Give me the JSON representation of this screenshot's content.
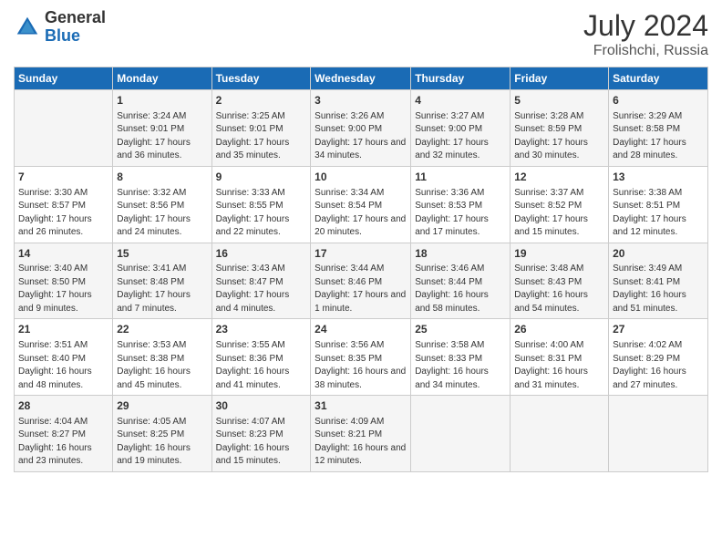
{
  "logo": {
    "general": "General",
    "blue": "Blue"
  },
  "title": {
    "month": "July 2024",
    "location": "Frolishchi, Russia"
  },
  "headers": [
    "Sunday",
    "Monday",
    "Tuesday",
    "Wednesday",
    "Thursday",
    "Friday",
    "Saturday"
  ],
  "weeks": [
    [
      {
        "day": "",
        "sunrise": "",
        "sunset": "",
        "daylight": ""
      },
      {
        "day": "1",
        "sunrise": "Sunrise: 3:24 AM",
        "sunset": "Sunset: 9:01 PM",
        "daylight": "Daylight: 17 hours and 36 minutes."
      },
      {
        "day": "2",
        "sunrise": "Sunrise: 3:25 AM",
        "sunset": "Sunset: 9:01 PM",
        "daylight": "Daylight: 17 hours and 35 minutes."
      },
      {
        "day": "3",
        "sunrise": "Sunrise: 3:26 AM",
        "sunset": "Sunset: 9:00 PM",
        "daylight": "Daylight: 17 hours and 34 minutes."
      },
      {
        "day": "4",
        "sunrise": "Sunrise: 3:27 AM",
        "sunset": "Sunset: 9:00 PM",
        "daylight": "Daylight: 17 hours and 32 minutes."
      },
      {
        "day": "5",
        "sunrise": "Sunrise: 3:28 AM",
        "sunset": "Sunset: 8:59 PM",
        "daylight": "Daylight: 17 hours and 30 minutes."
      },
      {
        "day": "6",
        "sunrise": "Sunrise: 3:29 AM",
        "sunset": "Sunset: 8:58 PM",
        "daylight": "Daylight: 17 hours and 28 minutes."
      }
    ],
    [
      {
        "day": "7",
        "sunrise": "Sunrise: 3:30 AM",
        "sunset": "Sunset: 8:57 PM",
        "daylight": "Daylight: 17 hours and 26 minutes."
      },
      {
        "day": "8",
        "sunrise": "Sunrise: 3:32 AM",
        "sunset": "Sunset: 8:56 PM",
        "daylight": "Daylight: 17 hours and 24 minutes."
      },
      {
        "day": "9",
        "sunrise": "Sunrise: 3:33 AM",
        "sunset": "Sunset: 8:55 PM",
        "daylight": "Daylight: 17 hours and 22 minutes."
      },
      {
        "day": "10",
        "sunrise": "Sunrise: 3:34 AM",
        "sunset": "Sunset: 8:54 PM",
        "daylight": "Daylight: 17 hours and 20 minutes."
      },
      {
        "day": "11",
        "sunrise": "Sunrise: 3:36 AM",
        "sunset": "Sunset: 8:53 PM",
        "daylight": "Daylight: 17 hours and 17 minutes."
      },
      {
        "day": "12",
        "sunrise": "Sunrise: 3:37 AM",
        "sunset": "Sunset: 8:52 PM",
        "daylight": "Daylight: 17 hours and 15 minutes."
      },
      {
        "day": "13",
        "sunrise": "Sunrise: 3:38 AM",
        "sunset": "Sunset: 8:51 PM",
        "daylight": "Daylight: 17 hours and 12 minutes."
      }
    ],
    [
      {
        "day": "14",
        "sunrise": "Sunrise: 3:40 AM",
        "sunset": "Sunset: 8:50 PM",
        "daylight": "Daylight: 17 hours and 9 minutes."
      },
      {
        "day": "15",
        "sunrise": "Sunrise: 3:41 AM",
        "sunset": "Sunset: 8:48 PM",
        "daylight": "Daylight: 17 hours and 7 minutes."
      },
      {
        "day": "16",
        "sunrise": "Sunrise: 3:43 AM",
        "sunset": "Sunset: 8:47 PM",
        "daylight": "Daylight: 17 hours and 4 minutes."
      },
      {
        "day": "17",
        "sunrise": "Sunrise: 3:44 AM",
        "sunset": "Sunset: 8:46 PM",
        "daylight": "Daylight: 17 hours and 1 minute."
      },
      {
        "day": "18",
        "sunrise": "Sunrise: 3:46 AM",
        "sunset": "Sunset: 8:44 PM",
        "daylight": "Daylight: 16 hours and 58 minutes."
      },
      {
        "day": "19",
        "sunrise": "Sunrise: 3:48 AM",
        "sunset": "Sunset: 8:43 PM",
        "daylight": "Daylight: 16 hours and 54 minutes."
      },
      {
        "day": "20",
        "sunrise": "Sunrise: 3:49 AM",
        "sunset": "Sunset: 8:41 PM",
        "daylight": "Daylight: 16 hours and 51 minutes."
      }
    ],
    [
      {
        "day": "21",
        "sunrise": "Sunrise: 3:51 AM",
        "sunset": "Sunset: 8:40 PM",
        "daylight": "Daylight: 16 hours and 48 minutes."
      },
      {
        "day": "22",
        "sunrise": "Sunrise: 3:53 AM",
        "sunset": "Sunset: 8:38 PM",
        "daylight": "Daylight: 16 hours and 45 minutes."
      },
      {
        "day": "23",
        "sunrise": "Sunrise: 3:55 AM",
        "sunset": "Sunset: 8:36 PM",
        "daylight": "Daylight: 16 hours and 41 minutes."
      },
      {
        "day": "24",
        "sunrise": "Sunrise: 3:56 AM",
        "sunset": "Sunset: 8:35 PM",
        "daylight": "Daylight: 16 hours and 38 minutes."
      },
      {
        "day": "25",
        "sunrise": "Sunrise: 3:58 AM",
        "sunset": "Sunset: 8:33 PM",
        "daylight": "Daylight: 16 hours and 34 minutes."
      },
      {
        "day": "26",
        "sunrise": "Sunrise: 4:00 AM",
        "sunset": "Sunset: 8:31 PM",
        "daylight": "Daylight: 16 hours and 31 minutes."
      },
      {
        "day": "27",
        "sunrise": "Sunrise: 4:02 AM",
        "sunset": "Sunset: 8:29 PM",
        "daylight": "Daylight: 16 hours and 27 minutes."
      }
    ],
    [
      {
        "day": "28",
        "sunrise": "Sunrise: 4:04 AM",
        "sunset": "Sunset: 8:27 PM",
        "daylight": "Daylight: 16 hours and 23 minutes."
      },
      {
        "day": "29",
        "sunrise": "Sunrise: 4:05 AM",
        "sunset": "Sunset: 8:25 PM",
        "daylight": "Daylight: 16 hours and 19 minutes."
      },
      {
        "day": "30",
        "sunrise": "Sunrise: 4:07 AM",
        "sunset": "Sunset: 8:23 PM",
        "daylight": "Daylight: 16 hours and 15 minutes."
      },
      {
        "day": "31",
        "sunrise": "Sunrise: 4:09 AM",
        "sunset": "Sunset: 8:21 PM",
        "daylight": "Daylight: 16 hours and 12 minutes."
      },
      {
        "day": "",
        "sunrise": "",
        "sunset": "",
        "daylight": ""
      },
      {
        "day": "",
        "sunrise": "",
        "sunset": "",
        "daylight": ""
      },
      {
        "day": "",
        "sunrise": "",
        "sunset": "",
        "daylight": ""
      }
    ]
  ]
}
